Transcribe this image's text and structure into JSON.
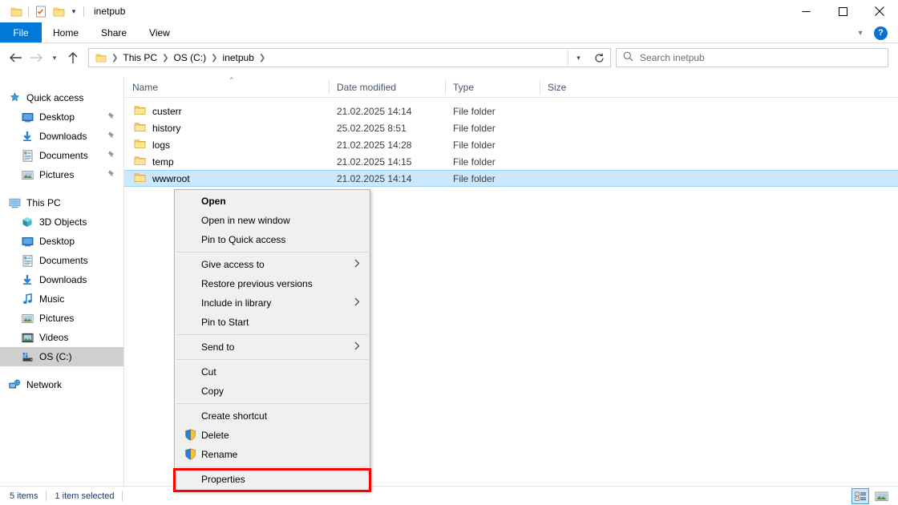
{
  "window": {
    "title": "inetpub",
    "quick_access_toolbar": [
      {
        "name": "folder-icon",
        "label": "Properties"
      },
      {
        "name": "properties-icon",
        "label": "Properties"
      },
      {
        "name": "new-folder-icon",
        "label": "New folder"
      }
    ],
    "controls": {
      "minimize": "minimize-icon",
      "maximize": "maximize-icon",
      "close": "close-icon"
    }
  },
  "ribbon": {
    "tabs": [
      {
        "label": "File",
        "active": true
      },
      {
        "label": "Home",
        "active": false
      },
      {
        "label": "Share",
        "active": false
      },
      {
        "label": "View",
        "active": false
      }
    ],
    "collapse_icon": "chevron-down-icon",
    "help_label": "?"
  },
  "addressbar": {
    "back_icon": "arrow-left-icon",
    "forward_icon": "arrow-right-icon",
    "history_icon": "chevron-down-icon",
    "up_icon": "arrow-up-icon",
    "breadcrumbs": [
      "This PC",
      "OS (C:)",
      "inetpub"
    ],
    "dropdown_icon": "chevron-down-icon",
    "refresh_icon": "refresh-icon"
  },
  "search": {
    "icon": "search-icon",
    "placeholder": "Search inetpub",
    "value": ""
  },
  "navpane": {
    "sections": [
      {
        "header": {
          "label": "Quick access",
          "icon": "star-pin-icon"
        },
        "items": [
          {
            "label": "Desktop",
            "icon": "desktop-icon",
            "pinned": true
          },
          {
            "label": "Downloads",
            "icon": "downloads-icon",
            "pinned": true
          },
          {
            "label": "Documents",
            "icon": "documents-icon",
            "pinned": true
          },
          {
            "label": "Pictures",
            "icon": "pictures-icon",
            "pinned": true
          }
        ]
      },
      {
        "header": {
          "label": "This PC",
          "icon": "this-pc-icon"
        },
        "items": [
          {
            "label": "3D Objects",
            "icon": "3d-objects-icon",
            "pinned": false
          },
          {
            "label": "Desktop",
            "icon": "desktop-icon",
            "pinned": false
          },
          {
            "label": "Documents",
            "icon": "documents-icon",
            "pinned": false
          },
          {
            "label": "Downloads",
            "icon": "downloads-icon",
            "pinned": false
          },
          {
            "label": "Music",
            "icon": "music-icon",
            "pinned": false
          },
          {
            "label": "Pictures",
            "icon": "pictures-icon",
            "pinned": false
          },
          {
            "label": "Videos",
            "icon": "videos-icon",
            "pinned": false
          },
          {
            "label": "OS (C:)",
            "icon": "drive-icon",
            "pinned": false,
            "selected": true
          }
        ]
      },
      {
        "header": {
          "label": "Network",
          "icon": "network-icon"
        },
        "items": []
      }
    ]
  },
  "filelist": {
    "columns": [
      {
        "label": "Name",
        "sorted": "asc"
      },
      {
        "label": "Date modified",
        "sorted": null
      },
      {
        "label": "Type",
        "sorted": null
      },
      {
        "label": "Size",
        "sorted": null
      }
    ],
    "sort_indicator": "chevron-up-icon",
    "rows": [
      {
        "name": "custerr",
        "date": "21.02.2025 14:14",
        "type": "File folder",
        "size": "",
        "selected": false
      },
      {
        "name": "history",
        "date": "25.02.2025 8:51",
        "type": "File folder",
        "size": "",
        "selected": false
      },
      {
        "name": "logs",
        "date": "21.02.2025 14:28",
        "type": "File folder",
        "size": "",
        "selected": false
      },
      {
        "name": "temp",
        "date": "21.02.2025 14:15",
        "type": "File folder",
        "size": "",
        "selected": false
      },
      {
        "name": "wwwroot",
        "date": "21.02.2025 14:14",
        "type": "File folder",
        "size": "",
        "selected": true
      }
    ]
  },
  "context_menu": {
    "items": [
      {
        "label": "Open",
        "bold": true,
        "submenu": false,
        "shield": false
      },
      {
        "label": "Open in new window",
        "bold": false,
        "submenu": false,
        "shield": false
      },
      {
        "label": "Pin to Quick access",
        "bold": false,
        "submenu": false,
        "shield": false
      },
      {
        "separator": true
      },
      {
        "label": "Give access to",
        "bold": false,
        "submenu": true,
        "shield": false
      },
      {
        "label": "Restore previous versions",
        "bold": false,
        "submenu": false,
        "shield": false
      },
      {
        "label": "Include in library",
        "bold": false,
        "submenu": true,
        "shield": false
      },
      {
        "label": "Pin to Start",
        "bold": false,
        "submenu": false,
        "shield": false
      },
      {
        "separator": true
      },
      {
        "label": "Send to",
        "bold": false,
        "submenu": true,
        "shield": false
      },
      {
        "separator": true
      },
      {
        "label": "Cut",
        "bold": false,
        "submenu": false,
        "shield": false
      },
      {
        "label": "Copy",
        "bold": false,
        "submenu": false,
        "shield": false
      },
      {
        "separator": true
      },
      {
        "label": "Create shortcut",
        "bold": false,
        "submenu": false,
        "shield": false
      },
      {
        "label": "Delete",
        "bold": false,
        "submenu": false,
        "shield": true
      },
      {
        "label": "Rename",
        "bold": false,
        "submenu": false,
        "shield": true
      },
      {
        "label": "Properties",
        "bold": false,
        "submenu": false,
        "shield": false,
        "highlighted": true
      }
    ],
    "submenu_icon": "chevron-right-icon",
    "shield_icon": "uac-shield-icon",
    "highlight_color": "#ff0000"
  },
  "statusbar": {
    "item_count": "5 items",
    "selection": "1 item selected",
    "view_buttons": [
      {
        "name": "details-view-icon",
        "active": true
      },
      {
        "name": "large-icons-view-icon",
        "active": false
      }
    ]
  }
}
